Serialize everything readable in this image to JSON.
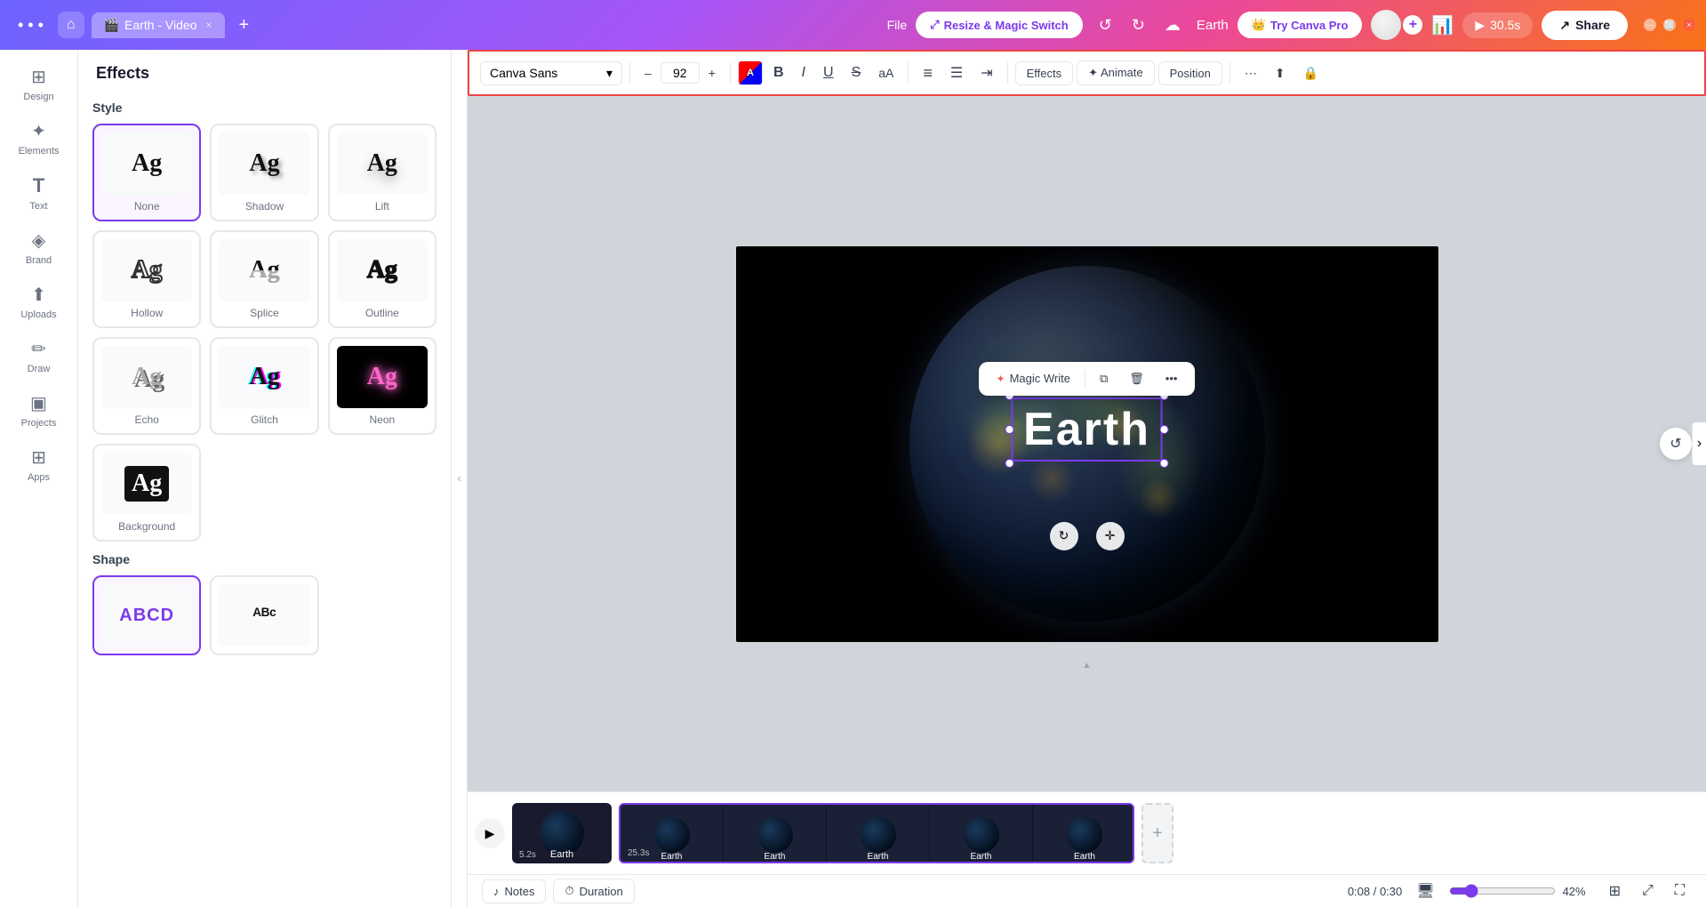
{
  "window": {
    "title": "Earth - Video",
    "tab_icon": "🎬",
    "tab_close": "×",
    "tab_add": "+",
    "minimize": "—",
    "maximize": "⬜",
    "close": "×"
  },
  "header": {
    "menu_dots": "• • •",
    "home_icon": "⌂",
    "file_label": "File",
    "resize_magic": "Resize & Magic Switch",
    "undo_icon": "↺",
    "redo_icon": "↻",
    "save_icon": "☁",
    "project_name": "Earth",
    "try_canva": "Try Canva Pro",
    "crown_icon": "👑",
    "share_icon": "↗",
    "share_label": "Share",
    "play_icon": "▶",
    "duration": "30.5s",
    "chart_icon": "📊"
  },
  "toolbar": {
    "font_family": "Canva Sans",
    "font_size": "92",
    "decrease_icon": "–",
    "increase_icon": "+",
    "bold_icon": "B",
    "italic_icon": "I",
    "underline_icon": "U",
    "strikethrough_icon": "S",
    "capitalize_icon": "aA",
    "align_left": "≡",
    "list_icon": "☰",
    "indent_icon": "⇥",
    "effects_label": "Effects",
    "animate_icon": "✦",
    "animate_label": "Animate",
    "position_label": "Position",
    "dots_icon": "⋯",
    "layer_up": "⬆",
    "lock_icon": "🔒"
  },
  "sidebar": {
    "items": [
      {
        "id": "design",
        "icon": "⊞",
        "label": "Design"
      },
      {
        "id": "elements",
        "icon": "✦",
        "label": "Elements"
      },
      {
        "id": "text",
        "icon": "T",
        "label": "Text"
      },
      {
        "id": "brand",
        "icon": "◈",
        "label": "Brand"
      },
      {
        "id": "uploads",
        "icon": "⬆",
        "label": "Uploads"
      },
      {
        "id": "draw",
        "icon": "✏",
        "label": "Draw"
      },
      {
        "id": "projects",
        "icon": "▣",
        "label": "Projects"
      },
      {
        "id": "apps",
        "icon": "⊞",
        "label": "Apps"
      }
    ]
  },
  "effects_panel": {
    "title": "Effects",
    "style_section": "Style",
    "styles": [
      {
        "id": "none",
        "label": "None",
        "preview_text": "Ag",
        "type": "none"
      },
      {
        "id": "shadow",
        "label": "Shadow",
        "preview_text": "Ag",
        "type": "shadow"
      },
      {
        "id": "lift",
        "label": "Lift",
        "preview_text": "Ag",
        "type": "lift"
      },
      {
        "id": "hollow",
        "label": "Hollow",
        "preview_text": "Ag",
        "type": "hollow"
      },
      {
        "id": "splice",
        "label": "Splice",
        "preview_text": "Ag",
        "type": "splice"
      },
      {
        "id": "outline",
        "label": "Outline",
        "preview_text": "Ag",
        "type": "outline"
      },
      {
        "id": "echo",
        "label": "Echo",
        "preview_text": "Ag",
        "type": "echo"
      },
      {
        "id": "glitch",
        "label": "Glitch",
        "preview_text": "Ag",
        "type": "glitch"
      },
      {
        "id": "neon",
        "label": "Neon",
        "preview_text": "Ag",
        "type": "neon"
      },
      {
        "id": "background",
        "label": "Background",
        "preview_text": "Ag",
        "type": "background"
      }
    ],
    "shape_section": "Shape",
    "shapes": [
      {
        "id": "rect",
        "label": "ABCD",
        "type": "rect"
      },
      {
        "id": "curve",
        "label": "ᴬᴮᶜ",
        "type": "curve"
      }
    ]
  },
  "canvas": {
    "text_content": "Earth",
    "context_menu": {
      "magic_write_icon": "✦",
      "magic_write_label": "Magic Write",
      "copy_icon": "⧉",
      "delete_icon": "🗑",
      "more_icon": "•••"
    }
  },
  "timeline": {
    "play_icon": "▶",
    "clip1": {
      "label": "Earth",
      "duration": "5.2s"
    },
    "clip2": {
      "label": "Earth",
      "duration": "25.3s"
    },
    "clip_sections": [
      "Earth",
      "Earth",
      "Earth",
      "Earth",
      "Earth"
    ],
    "add_icon": "+",
    "time_current": "0:08",
    "time_total": "0:30"
  },
  "bottom_bar": {
    "notes_icon": "♪",
    "notes_label": "Notes",
    "duration_icon": "⏱",
    "duration_label": "Duration",
    "time_display": "0:08 / 0:30",
    "monitor_icon": "🖥",
    "zoom_percent": "42%",
    "grid_icon": "⊞",
    "fit_icon": "⤢",
    "fullscreen_icon": "⛶"
  }
}
